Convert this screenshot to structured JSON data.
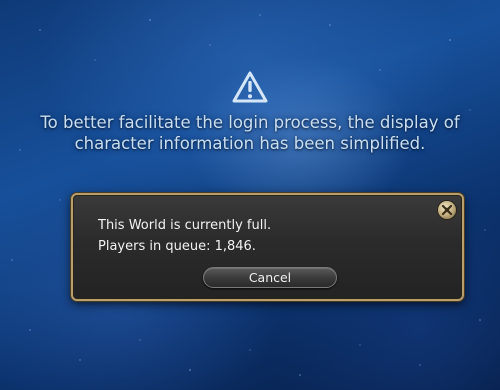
{
  "notice": {
    "icon": "warning-triangle-icon",
    "text": "To better facilitate the login process, the display of character information has been simplified."
  },
  "dialog": {
    "line1": "This World is currently full.",
    "line2": "Players in queue: 1,846.",
    "cancel_label": "Cancel",
    "close_icon": "close-emblem-icon",
    "border_color": "#b89f6c"
  }
}
